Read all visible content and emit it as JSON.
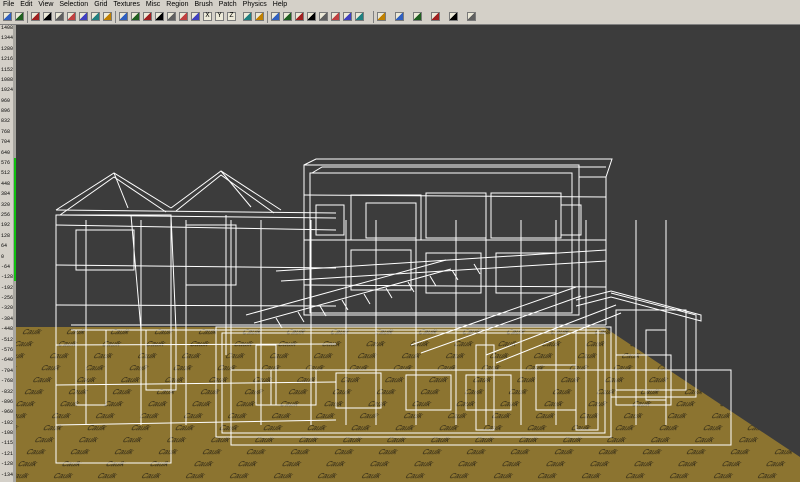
{
  "menu": [
    "File",
    "Edit",
    "View",
    "Selection",
    "Grid",
    "Textures",
    "Misc",
    "Region",
    "Brush",
    "Patch",
    "Physics",
    "Help"
  ],
  "toolbar": {
    "axis_buttons": [
      "X",
      "Y",
      "Z"
    ],
    "icons": [
      "new-map-icon",
      "save-icon",
      "move-icon",
      "rotate-icon",
      "scale-icon",
      "flip-x-icon",
      "flip-y-icon",
      "rotate-x-icon",
      "rotate-y-icon",
      "select-complete-tall-icon",
      "select-touching-icon",
      "select-partial-tall-icon",
      "select-inside-icon",
      "csg-subtract-icon",
      "csg-merge-icon",
      "hollow-icon",
      "clipper-icon",
      "texture-lock-icon",
      "camera-icon",
      "cubic-clip-icon",
      "view-change-icon",
      "entity-icon",
      "brush-icon",
      "patch-icon",
      "light-icon",
      "model-icon",
      "sound-icon",
      "particle-icon",
      "monster-icon",
      "speaker-icon",
      "path-icon",
      "arrow-icon"
    ]
  },
  "ruler": {
    "labels": [
      "1408",
      "1344",
      "1280",
      "1216",
      "1152",
      "1088",
      "1024",
      "960",
      "896",
      "832",
      "768",
      "704",
      "640",
      "576",
      "512",
      "448",
      "384",
      "320",
      "256",
      "192",
      "128",
      "64",
      "0",
      "-64",
      "-128",
      "-192",
      "-256",
      "-320",
      "-384",
      "-448",
      "-512",
      "-576",
      "-640",
      "-704",
      "-768",
      "-832",
      "-896",
      "-960",
      "-1024",
      "-1088",
      "-1152",
      "-1216",
      "-1280",
      "-1344"
    ],
    "thumb_fraction_start": 0.29,
    "thumb_fraction_end": 0.56,
    "thumb_color": "#10c010"
  },
  "viewport": {
    "background_color": "#3c3c3c",
    "wireframe_color": "#ffffff",
    "floor_color": "#8c7430",
    "floor_texture_label": "Caulk"
  }
}
